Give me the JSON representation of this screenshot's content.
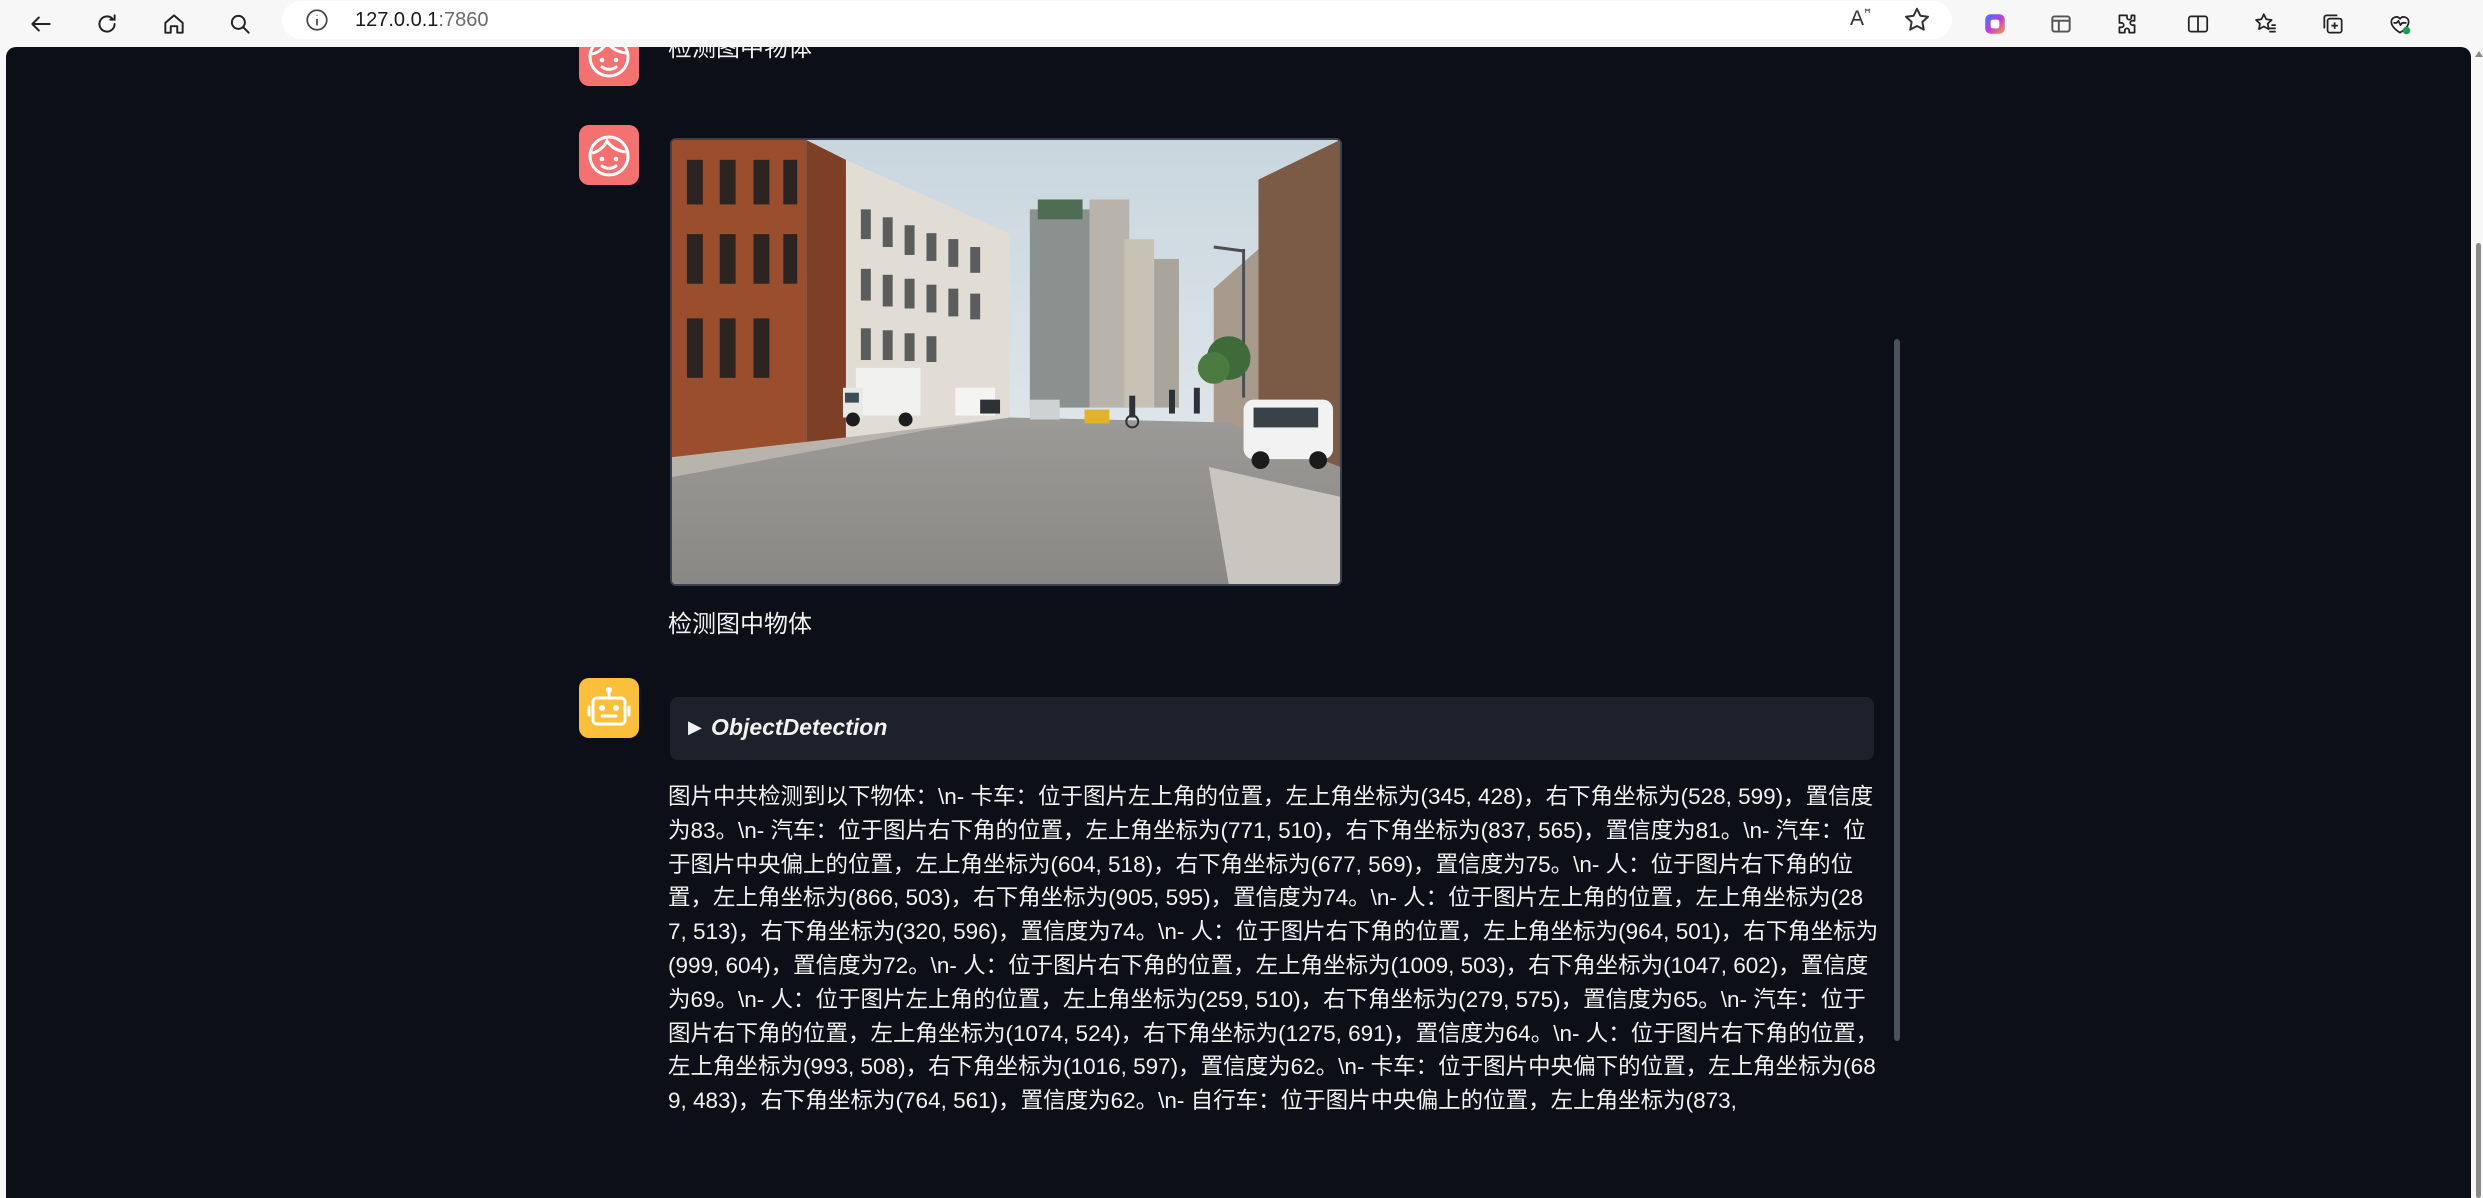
{
  "browser": {
    "url_host": "127.0.0.1",
    "url_port": ":7860",
    "read_aloud_label": "A̅ʰ"
  },
  "chat": {
    "previous_user_text": "检测图中物体",
    "user_image_caption": "检测图中物体",
    "tool_label": "ObjectDetection",
    "bot_response": "图片中共检测到以下物体：\\n- 卡车：位于图片左上角的位置，左上角坐标为(345, 428)，右下角坐标为(528, 599)，置信度为83。\\n- 汽车：位于图片右下角的位置，左上角坐标为(771, 510)，右下角坐标为(837, 565)，置信度为81。\\n- 汽车：位于图片中央偏上的位置，左上角坐标为(604, 518)，右下角坐标为(677, 569)，置信度为75。\\n- 人：位于图片右下角的位置，左上角坐标为(866, 503)，右下角坐标为(905, 595)，置信度为74。\\n- 人：位于图片左上角的位置，左上角坐标为(287, 513)，右下角坐标为(320, 596)，置信度为74。\\n- 人：位于图片右下角的位置，左上角坐标为(964, 501)，右下角坐标为(999, 604)，置信度为72。\\n- 人：位于图片右下角的位置，左上角坐标为(1009, 503)，右下角坐标为(1047, 602)，置信度为69。\\n- 人：位于图片左上角的位置，左上角坐标为(259, 510)，右下角坐标为(279, 575)，置信度为65。\\n- 汽车：位于图片右下角的位置，左上角坐标为(1074, 524)，右下角坐标为(1275, 691)，置信度为64。\\n- 人：位于图片右下角的位置，左上角坐标为(993, 508)，右下角坐标为(1016, 597)，置信度为62。\\n- 卡车：位于图片中央偏下的位置，左上角坐标为(689, 483)，右下角坐标为(764, 561)，置信度为62。\\n- 自行车：位于图片中央偏上的位置，左上角坐标为(873,"
  },
  "colors": {
    "app_background": "#0c0f17",
    "user_avatar": "#f47171",
    "bot_avatar": "#fbbf3c",
    "accordion": "#1c212b"
  }
}
